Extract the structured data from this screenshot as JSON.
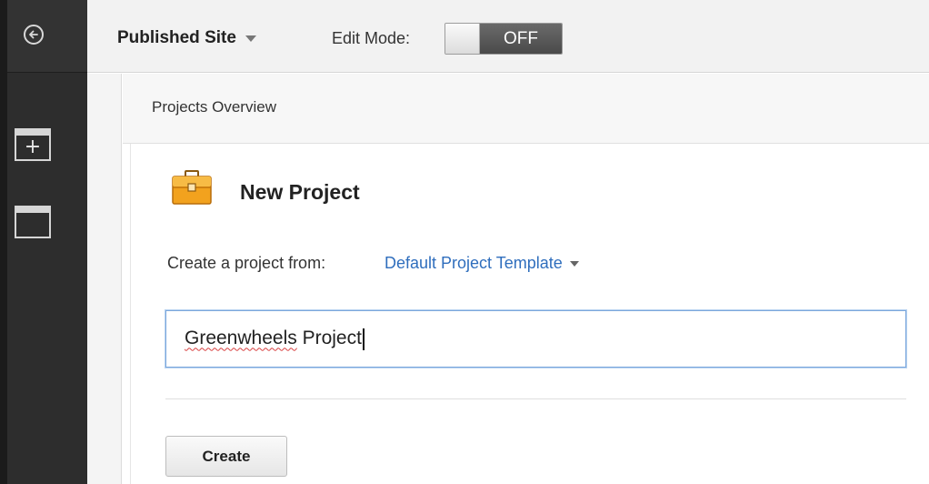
{
  "topbar": {
    "published_label": "Published Site",
    "edit_mode_label": "Edit Mode:",
    "edit_mode_state": "OFF"
  },
  "breadcrumb": {
    "label": "Projects Overview"
  },
  "dialog": {
    "title": "New Project",
    "create_from_label": "Create a project from:",
    "template_selected": "Default Project Template",
    "name_input": {
      "value_misspelled": "Greenwheels",
      "value_rest": " Project"
    },
    "create_button_label": "Create"
  },
  "icons": {
    "rail_back": "back-arrow-circle-icon",
    "rail_add_page": "add-panel-icon",
    "rail_page": "page-panel-icon",
    "dropdown": "caret-down-icon",
    "project": "briefcase-icon"
  },
  "colors": {
    "rail": "#2d2d2d",
    "topbar": "#f2f2f2",
    "link": "#2f6ebd",
    "toggle_state_bg": "#555555",
    "input_focus_border": "#7ba7dc",
    "briefcase": "#f2a21e"
  }
}
